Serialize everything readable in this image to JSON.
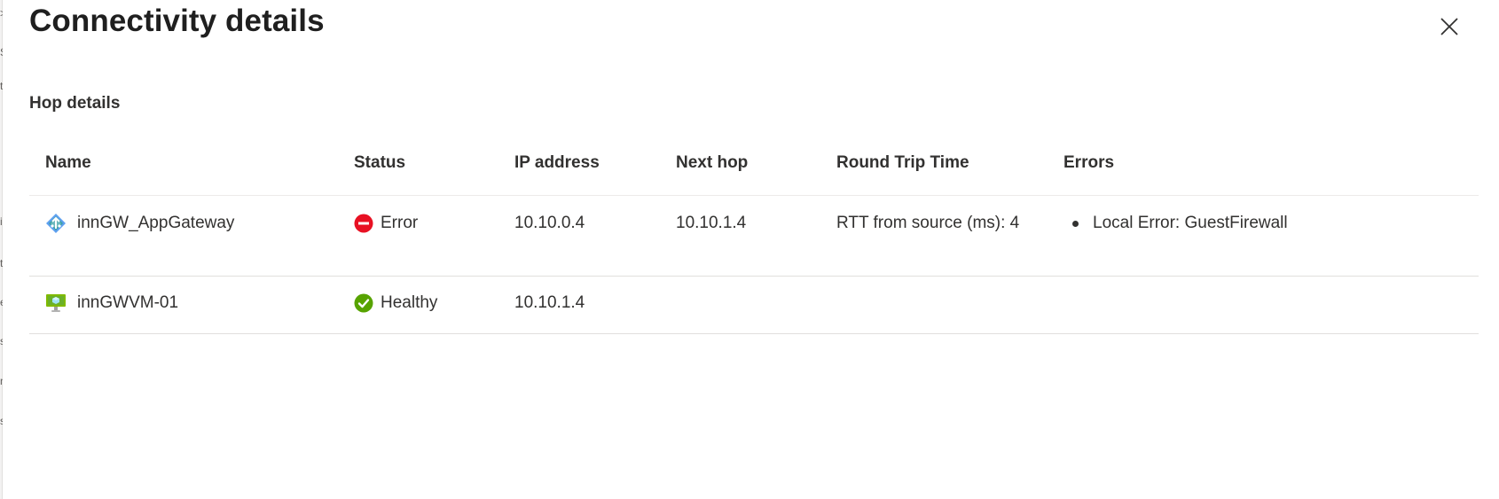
{
  "backdrop": {
    "fragments": [
      ">",
      "S",
      "t",
      "i",
      "t",
      "e",
      "s",
      "n",
      "s"
    ]
  },
  "panel": {
    "title": "Connectivity details",
    "close_icon": "close-icon"
  },
  "hop_details": {
    "section_title": "Hop details",
    "columns": [
      "Name",
      "Status",
      "IP address",
      "Next hop",
      "Round Trip Time",
      "Errors"
    ],
    "rows": [
      {
        "name": "innGW_AppGateway",
        "icon": "app-gateway-icon",
        "status": "Error",
        "status_icon": "error-icon",
        "ip_address": "10.10.0.4",
        "next_hop": "10.10.1.4",
        "rtt": "RTT from source (ms): 4",
        "errors": [
          "Local Error: GuestFirewall"
        ]
      },
      {
        "name": "innGWVM-01",
        "icon": "virtual-machine-icon",
        "status": "Healthy",
        "status_icon": "healthy-icon",
        "ip_address": "10.10.1.4",
        "next_hop": "",
        "rtt": "",
        "errors": []
      }
    ]
  },
  "colors": {
    "error": "#e81123",
    "healthy": "#57a300",
    "gateway": "#5ea0ef",
    "vm": "#7fba00",
    "divider": "#e1dfdd"
  }
}
